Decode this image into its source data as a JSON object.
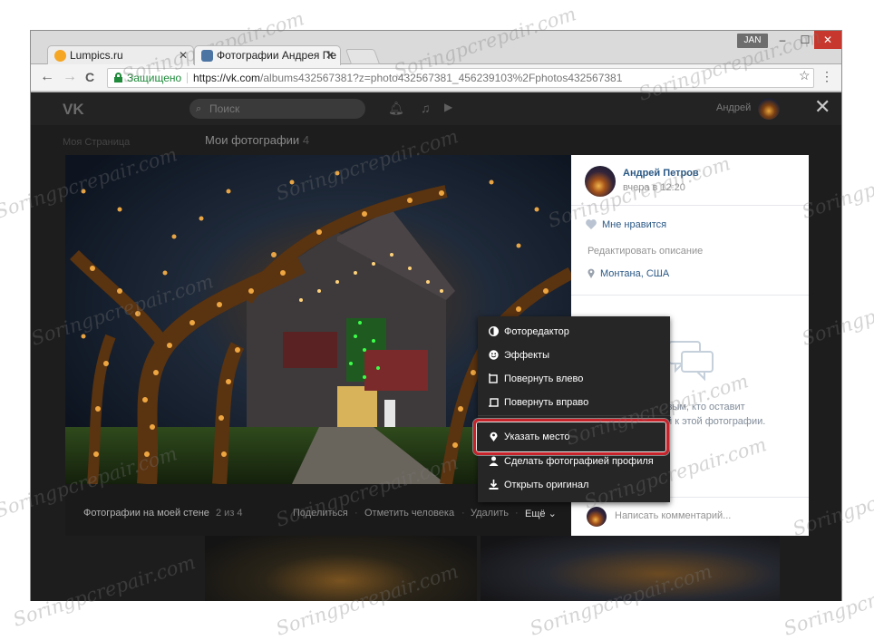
{
  "window": {
    "user_badge": "JAN",
    "minimize_glyph": "–",
    "maximize_glyph": "☐",
    "close_glyph": "✕",
    "tabs": [
      {
        "title": "Lumpics.ru",
        "close": "✕"
      },
      {
        "title": "Фотографии Андрея Пе",
        "close": "✕"
      }
    ]
  },
  "toolbar": {
    "back": "←",
    "forward": "→",
    "reload": "C",
    "secure_label": "Защищено",
    "url_host": "https://vk.com",
    "url_path": "/albums432567381?z=photo432567381_456239103%2Fphotos432567381",
    "bookmark_glyph": "☆",
    "menu_glyph": "⋮"
  },
  "vk_header": {
    "logo": "VK",
    "search_placeholder": "Поиск",
    "user_name": "Андрей",
    "close_glyph": "✕"
  },
  "background_page": {
    "breadcrumb": "Моя Страница",
    "title": "Мои фотографии",
    "count": "4"
  },
  "photo_bar": {
    "album_title": "Фотографии на моей стене",
    "position": "2 из 4",
    "actions": [
      "Поделиться",
      "Отметить человека",
      "Удалить"
    ],
    "more": "Ещё",
    "more_chevron": "⌄"
  },
  "side_panel": {
    "author": "Андрей Петров",
    "time": "вчера в 12:20",
    "like": "Мне нравится",
    "edit_description": "Редактировать описание",
    "place": "Монтана, США",
    "empty_comments_line1": "дьте первым, кто оставит",
    "empty_comments_line2": "ментарий к этой фотографии.",
    "comment_placeholder": "Написать комментарий..."
  },
  "more_menu": {
    "items": [
      {
        "label": "Фоторедактор",
        "icon": "contrast-icon"
      },
      {
        "label": "Эффекты",
        "icon": "smile-icon"
      },
      {
        "label": "Повернуть влево",
        "icon": "rotate-left-icon"
      },
      {
        "label": "Повернуть вправо",
        "icon": "rotate-right-icon"
      },
      {
        "label": "Указать место",
        "icon": "map-pin-icon"
      },
      {
        "label": "Сделать фотографией профиля",
        "icon": "user-icon"
      },
      {
        "label": "Открыть оригинал",
        "icon": "download-icon"
      }
    ],
    "highlighted": "Указать место"
  },
  "watermark": "Soringpcrepair.com",
  "colors": {
    "vk_link": "#2a5885",
    "highlight_border": "#c8232b",
    "secure_green": "#1e8a3a",
    "menu_bg": "#262626"
  }
}
